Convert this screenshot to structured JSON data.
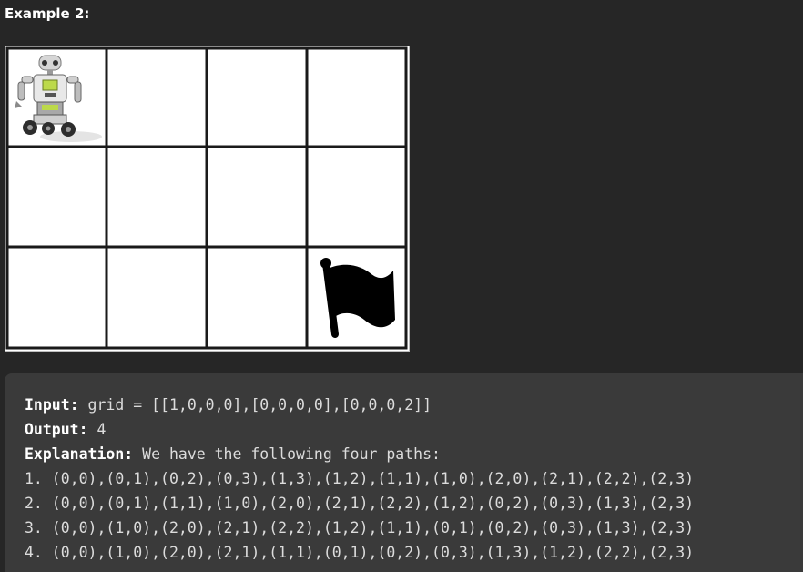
{
  "example": {
    "title": "Example 2:"
  },
  "figure": {
    "robot_icon": "robot-icon",
    "flag_icon": "flag-icon",
    "grid_line_color": "#1a1a1a",
    "cell_color": "#ffffff"
  },
  "code": {
    "input_label": "Input:",
    "input_value": " grid = [[1,0,0,0],[0,0,0,0],[0,0,0,2]]",
    "output_label": "Output:",
    "output_value": " 4",
    "explanation_label": "Explanation:",
    "explanation_value": " We have the following four paths:",
    "paths": [
      "1. (0,0),(0,1),(0,2),(0,3),(1,3),(1,2),(1,1),(1,0),(2,0),(2,1),(2,2),(2,3)",
      "2. (0,0),(0,1),(1,1),(1,0),(2,0),(2,1),(2,2),(1,2),(0,2),(0,3),(1,3),(2,3)",
      "3. (0,0),(1,0),(2,0),(2,1),(2,2),(1,2),(1,1),(0,1),(0,2),(0,3),(1,3),(2,3)",
      "4. (0,0),(1,0),(2,0),(2,1),(1,1),(0,1),(0,2),(0,3),(1,3),(1,2),(2,2),(2,3)"
    ]
  },
  "colors": {
    "page_background": "#262626",
    "code_background": "#3a3a3a",
    "code_text": "#dcdcdc",
    "label_text": "#ffffff"
  }
}
